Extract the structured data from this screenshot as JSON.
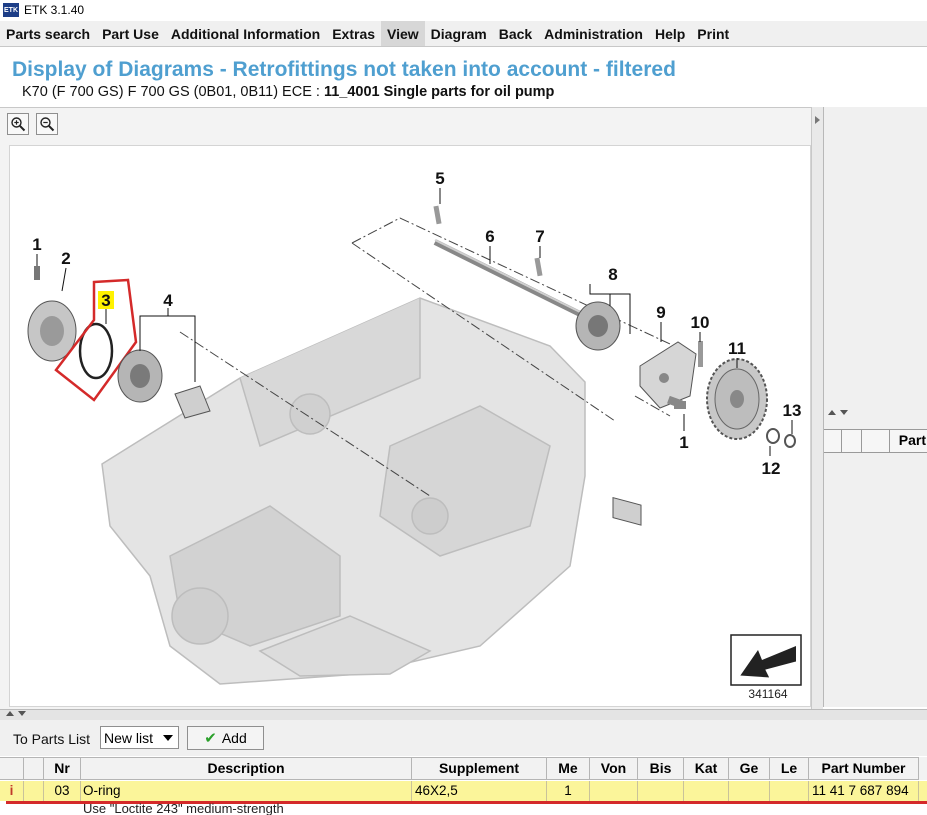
{
  "window": {
    "title": "ETK 3.1.40",
    "icon_text": "ETK"
  },
  "menu": [
    {
      "label": "Parts search",
      "active": false
    },
    {
      "label": "Part Use",
      "active": false
    },
    {
      "label": "Additional Information",
      "active": false
    },
    {
      "label": "Extras",
      "active": false
    },
    {
      "label": "View",
      "active": true
    },
    {
      "label": "Diagram",
      "active": false
    },
    {
      "label": "Back",
      "active": false
    },
    {
      "label": "Administration",
      "active": false
    },
    {
      "label": "Help",
      "active": false
    },
    {
      "label": "Print",
      "active": false
    }
  ],
  "header": {
    "title": "Display of Diagrams - Retrofittings not taken into account - filtered",
    "subtitle_prefix": "K70 (F 700 GS) F 700 GS (0B01, 0B11) ECE : ",
    "subtitle_bold": "11_4001 Single parts for oil pump"
  },
  "diagram": {
    "number": "341164",
    "labels": [
      "1",
      "2",
      "3",
      "4",
      "5",
      "6",
      "7",
      "8",
      "9",
      "10",
      "11",
      "1",
      "12",
      "13"
    ],
    "highlighted_label": "3",
    "highlight_color": "#d42a2a"
  },
  "right_panel": {
    "header_label": "Part"
  },
  "toolbar": {
    "to_parts_list_label": "To Parts List",
    "list_select_value": "New list",
    "add_label": "Add"
  },
  "table": {
    "columns": [
      "",
      "",
      "Nr",
      "Description",
      "Supplement",
      "Me",
      "Von",
      "Bis",
      "Kat",
      "Ge",
      "Le",
      "Part Number"
    ],
    "rows": [
      {
        "info": "i",
        "nr": "03",
        "description": "O-ring",
        "supplement": "46X2,5",
        "me": "1",
        "von": "",
        "bis": "",
        "kat": "",
        "ge": "",
        "le": "",
        "part_number": "11 41 7 687 894"
      }
    ],
    "note": "Use \"Loctite 243\" medium-strength",
    "row_highlight": "#fbf59a"
  }
}
